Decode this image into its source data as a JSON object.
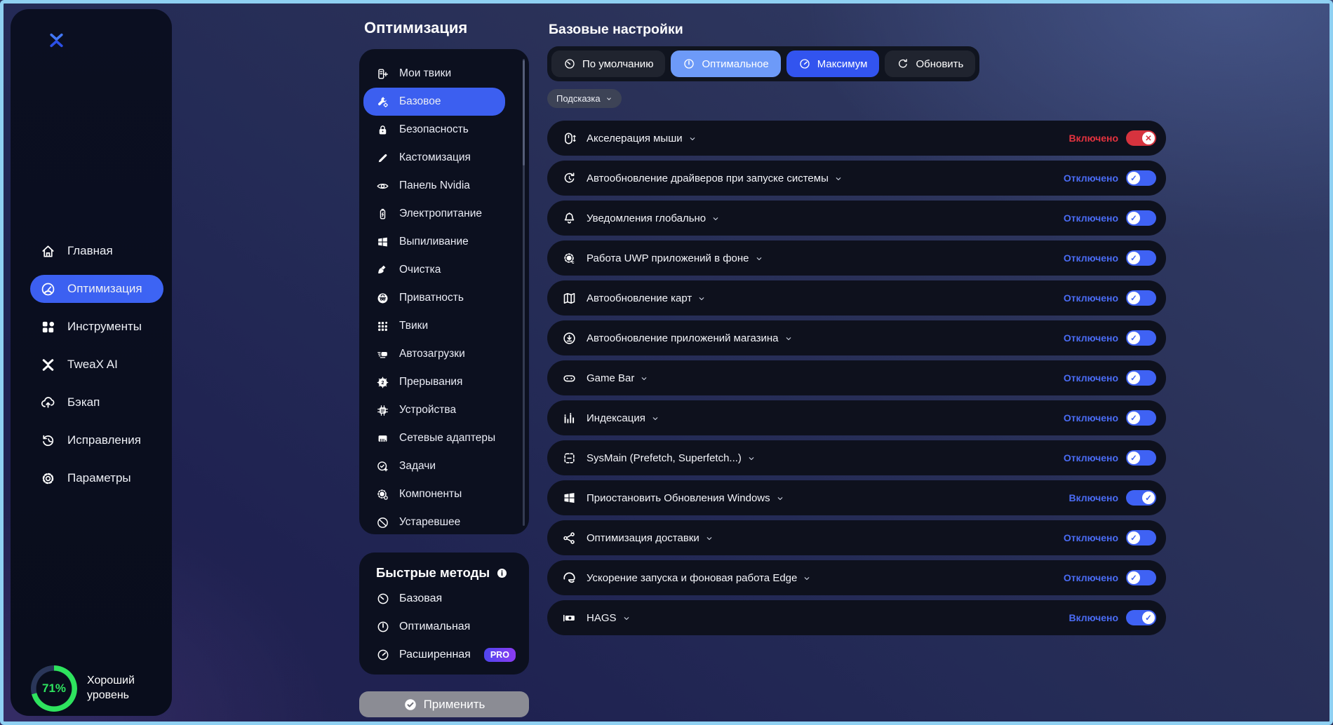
{
  "window": {
    "controls": [
      {
        "icon": "minimize"
      },
      {
        "icon": "maximize"
      },
      {
        "icon": "close"
      }
    ]
  },
  "colors": {
    "accent_blue": "#3c5ff0",
    "toggle_blue": "#3f62f4",
    "toggle_red": "#d6333e",
    "state_text_blue": "#4a6cf5",
    "state_text_red": "#e5333f",
    "score_green": "#2ee35e",
    "preset_light_blue": "#6d9af8",
    "preset_blue": "#3254ef",
    "pro_gradient_from": "#4f46ee",
    "pro_gradient_to": "#8b3bf2",
    "frame_border": "#8fd0f2"
  },
  "sidebar": {
    "logo_icon": "tweax",
    "nav": [
      {
        "label": "Главная",
        "icon": "home"
      },
      {
        "label": "Оптимизация",
        "icon": "speedometer",
        "selected": true
      },
      {
        "label": "Инструменты",
        "icon": "tools"
      },
      {
        "label": "TweaX AI",
        "icon": "tweax"
      },
      {
        "label": "Бэкап",
        "icon": "cloud-up"
      },
      {
        "label": "Исправления",
        "icon": "history"
      },
      {
        "label": "Параметры",
        "icon": "gear"
      }
    ],
    "score": {
      "percent": "71%",
      "label": "Хороший уровень"
    }
  },
  "categories": {
    "title": "Оптимизация",
    "items": [
      {
        "label": "Мои твики",
        "icon": "tweaks-list"
      },
      {
        "label": "Базовое",
        "icon": "wrench-gear",
        "selected": true
      },
      {
        "label": "Безопасность",
        "icon": "lock"
      },
      {
        "label": "Кастомизация",
        "icon": "pen"
      },
      {
        "label": "Панель Nvidia",
        "icon": "nvidia"
      },
      {
        "label": "Электропитание",
        "icon": "battery"
      },
      {
        "label": "Выпиливание",
        "icon": "windows"
      },
      {
        "label": "Очистка",
        "icon": "broom"
      },
      {
        "label": "Приватность",
        "icon": "incognito"
      },
      {
        "label": "Твики",
        "icon": "dots-grid"
      },
      {
        "label": "Автозагрузки",
        "icon": "startup"
      },
      {
        "label": "Прерывания",
        "icon": "interrupts"
      },
      {
        "label": "Устройства",
        "icon": "devices"
      },
      {
        "label": "Сетевые адаптеры",
        "icon": "network"
      },
      {
        "label": "Задачи",
        "icon": "tasks"
      },
      {
        "label": "Компоненты",
        "icon": "components"
      },
      {
        "label": "Устаревшее",
        "icon": "prohibited"
      }
    ]
  },
  "quick_methods": {
    "title": "Быстрые методы",
    "info_icon": "info",
    "items": [
      {
        "label": "Базовая",
        "icon": "gauge-low"
      },
      {
        "label": "Оптимальная",
        "icon": "gauge-mid"
      },
      {
        "label": "Расширенная",
        "icon": "gauge-high",
        "badge": "PRO"
      }
    ]
  },
  "apply": {
    "label": "Применить",
    "icon": "apply-check"
  },
  "main": {
    "title": "Базовые настройки",
    "chevron_icon": "chev",
    "hint_label": "Подсказка",
    "presets": [
      {
        "label": "По умолчанию",
        "icon": "gauge-low",
        "variant": "plain"
      },
      {
        "label": "Оптимальное",
        "icon": "gauge-mid",
        "variant": "highlight-light"
      },
      {
        "label": "Максимум",
        "icon": "gauge-high",
        "variant": "highlight"
      },
      {
        "label": "Обновить",
        "icon": "refresh",
        "variant": "plain"
      }
    ],
    "settings": [
      {
        "label": "Акселерация мыши",
        "icon": "mouse",
        "state": "Включено",
        "variant": "st-on-red"
      },
      {
        "label": "Автообновление драйверов при запуске системы",
        "icon": "driver-refresh",
        "state": "Отключено",
        "variant": "st-off-blue"
      },
      {
        "label": "Уведомления глобально",
        "icon": "bell",
        "state": "Отключено",
        "variant": "st-off-blue"
      },
      {
        "label": "Работа UWP приложений в фоне",
        "icon": "uwp",
        "state": "Отключено",
        "variant": "st-off-blue"
      },
      {
        "label": "Автообновление карт",
        "icon": "map",
        "state": "Отключено",
        "variant": "st-off-blue"
      },
      {
        "label": "Автообновление приложений магазина",
        "icon": "store-download",
        "state": "Отключено",
        "variant": "st-off-blue"
      },
      {
        "label": "Game Bar",
        "icon": "gamepad",
        "state": "Отключено",
        "variant": "st-off-blue"
      },
      {
        "label": "Индексация",
        "icon": "indexing",
        "state": "Отключено",
        "variant": "st-off-blue"
      },
      {
        "label": "SysMain (Prefetch, Superfetch...)",
        "icon": "sysmain",
        "state": "Отключено",
        "variant": "st-off-blue"
      },
      {
        "label": "Приостановить Обновления Windows",
        "icon": "windows",
        "state": "Включено",
        "variant": "st-on-blue"
      },
      {
        "label": "Оптимизация доставки",
        "icon": "share",
        "state": "Отключено",
        "variant": "st-off-blue"
      },
      {
        "label": "Ускорение запуска и фоновая работа Edge",
        "icon": "edge",
        "state": "Отключено",
        "variant": "st-off-blue"
      },
      {
        "label": "HAGS",
        "icon": "hags",
        "state": "Включено",
        "variant": "st-on-blue"
      }
    ]
  }
}
